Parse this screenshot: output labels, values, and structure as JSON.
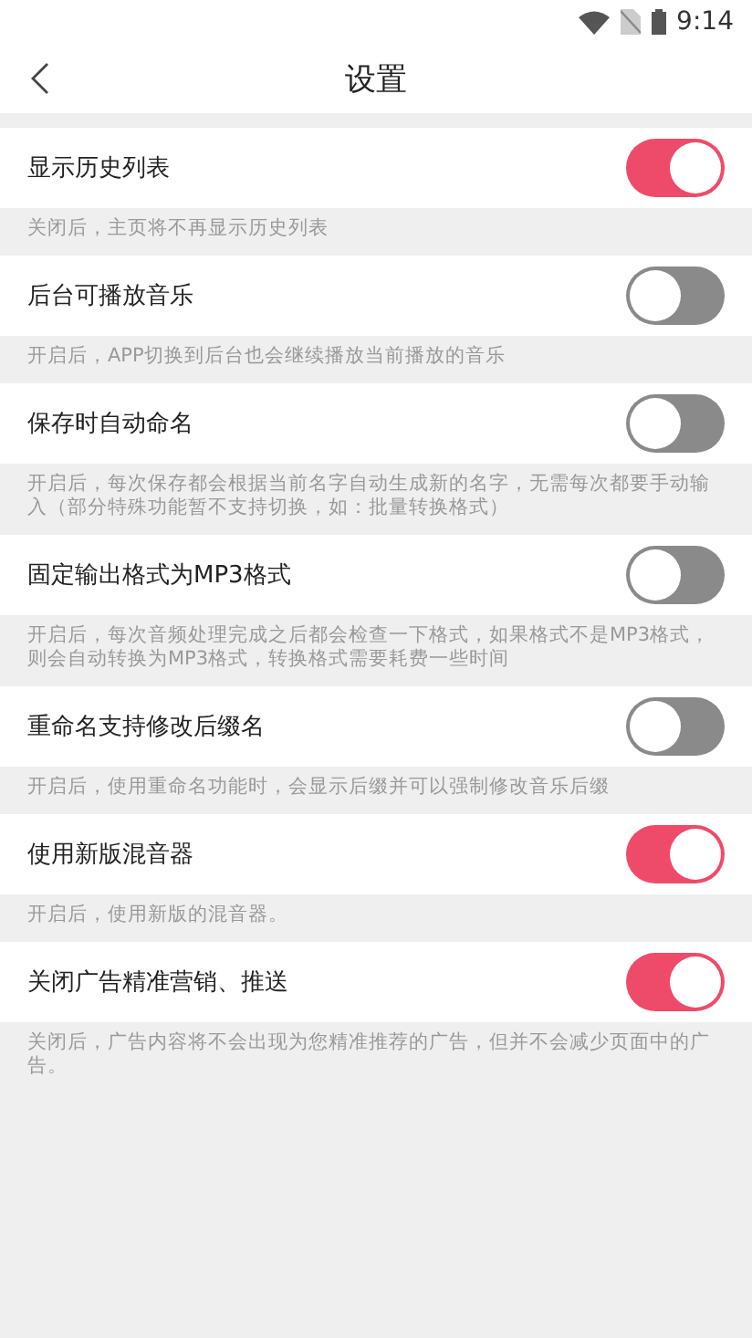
{
  "status_bar": {
    "time": "9:14"
  },
  "header": {
    "title": "设置"
  },
  "settings": [
    {
      "label": "显示历史列表",
      "on": true,
      "description": "关闭后，主页将不再显示历史列表"
    },
    {
      "label": "后台可播放音乐",
      "on": false,
      "description": "开启后，APP切换到后台也会继续播放当前播放的音乐"
    },
    {
      "label": "保存时自动命名",
      "on": false,
      "description": "开启后，每次保存都会根据当前名字自动生成新的名字，无需每次都要手动输入（部分特殊功能暂不支持切换，如：批量转换格式）"
    },
    {
      "label": "固定输出格式为MP3格式",
      "on": false,
      "description": "开启后，每次音频处理完成之后都会检查一下格式，如果格式不是MP3格式，则会自动转换为MP3格式，转换格式需要耗费一些时间"
    },
    {
      "label": "重命名支持修改后缀名",
      "on": false,
      "description": "开启后，使用重命名功能时，会显示后缀并可以强制修改音乐后缀"
    },
    {
      "label": "使用新版混音器",
      "on": true,
      "description": "开启后，使用新版的混音器。"
    },
    {
      "label": "关闭广告精准营销、推送",
      "on": true,
      "description": "关闭后，广告内容将不会出现为您精准推荐的广告，但并不会减少页面中的广告。"
    }
  ]
}
